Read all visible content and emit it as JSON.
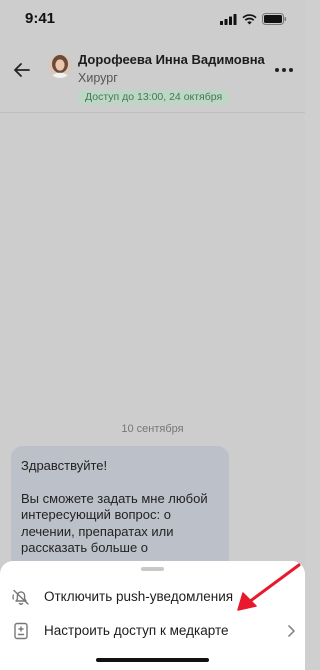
{
  "status_bar": {
    "time": "9:41"
  },
  "header": {
    "doctor_name": "Дорофеева Инна Вадимовна",
    "doctor_role": "Хирург",
    "access_badge": "Доступ до 13:00, 24 октября",
    "icons": {
      "back": "back-arrow-icon",
      "more": "more-dots-icon"
    }
  },
  "chat": {
    "date_label": "10 сентября",
    "message": {
      "greeting": "Здравствуйте!",
      "body": "Вы сможете задать мне любой интересующий вопрос: о лечении, препаратах или рассказать больше о"
    }
  },
  "bottom_sheet": {
    "items": [
      {
        "label": "Отключить push-уведомления",
        "icon": "bell-off-icon"
      },
      {
        "label": "Настроить доступ к медкарте",
        "icon": "medical-card-icon"
      }
    ]
  },
  "colors": {
    "badge_bg": "#bfd6c6",
    "badge_text": "#3f7a52",
    "annotation_arrow": "#e8192c"
  }
}
